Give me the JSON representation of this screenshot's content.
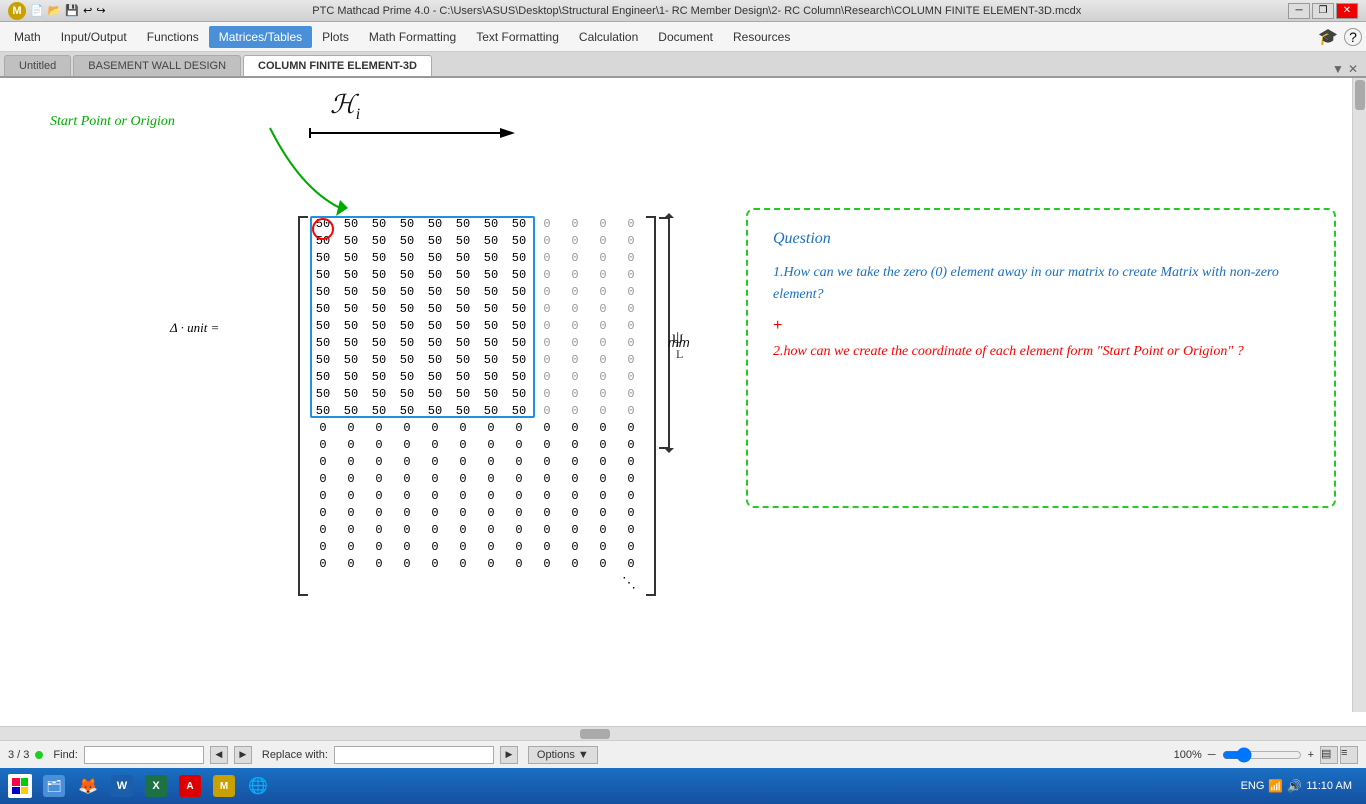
{
  "titlebar": {
    "icon_label": "M",
    "title": "PTC Mathcad Prime 4.0 - C:\\Users\\ASUS\\Desktop\\Structural Engineer\\1- RC Member Design\\2- RC Column\\Research\\COLUMN FINITE ELEMENT-3D.mcdx",
    "minimize": "─",
    "restore": "❐",
    "close": "✕"
  },
  "menubar": {
    "items": [
      "Math",
      "Input/Output",
      "Functions",
      "Matrices/Tables",
      "Plots",
      "Math Formatting",
      "Text Formatting",
      "Calculation",
      "Document",
      "Resources"
    ],
    "active_index": 3
  },
  "tabs": {
    "items": [
      "Untitled",
      "BASEMENT WALL DESIGN",
      "COLUMN FINITE ELEMENT-3D"
    ],
    "active_index": 2,
    "close_symbol": "▼ ✕"
  },
  "annotation": {
    "start_point_label": "Start Point or Origion",
    "matrix_label": "Δ · unit =",
    "mm_label": "mm",
    "question_title": "Question",
    "question_1": "1.How can we take the zero (0) element away in our matrix to create Matrix with non-zero element?",
    "plus_sign": "+",
    "question_2": "2.how can we create the coordinate of each element form \"Start Point or Origion\" ?"
  },
  "matrix": {
    "rows_50": [
      [
        50,
        50,
        50,
        50,
        50,
        50,
        50,
        50,
        0,
        0,
        0,
        0
      ],
      [
        50,
        50,
        50,
        50,
        50,
        50,
        50,
        50,
        0,
        0,
        0,
        0
      ],
      [
        50,
        50,
        50,
        50,
        50,
        50,
        50,
        50,
        0,
        0,
        0,
        0
      ],
      [
        50,
        50,
        50,
        50,
        50,
        50,
        50,
        50,
        0,
        0,
        0,
        0
      ],
      [
        50,
        50,
        50,
        50,
        50,
        50,
        50,
        50,
        0,
        0,
        0,
        0
      ],
      [
        50,
        50,
        50,
        50,
        50,
        50,
        50,
        50,
        0,
        0,
        0,
        0
      ],
      [
        50,
        50,
        50,
        50,
        50,
        50,
        50,
        50,
        0,
        0,
        0,
        0
      ],
      [
        50,
        50,
        50,
        50,
        50,
        50,
        50,
        50,
        0,
        0,
        0,
        0
      ],
      [
        50,
        50,
        50,
        50,
        50,
        50,
        50,
        50,
        0,
        0,
        0,
        0
      ],
      [
        50,
        50,
        50,
        50,
        50,
        50,
        50,
        50,
        0,
        0,
        0,
        0
      ],
      [
        50,
        50,
        50,
        50,
        50,
        50,
        50,
        50,
        0,
        0,
        0,
        0
      ],
      [
        50,
        50,
        50,
        50,
        50,
        50,
        50,
        50,
        0,
        0,
        0,
        0
      ]
    ],
    "rows_0": [
      [
        0,
        0,
        0,
        0,
        0,
        0,
        0,
        0,
        0,
        0,
        0,
        0
      ],
      [
        0,
        0,
        0,
        0,
        0,
        0,
        0,
        0,
        0,
        0,
        0,
        0
      ],
      [
        0,
        0,
        0,
        0,
        0,
        0,
        0,
        0,
        0,
        0,
        0,
        0
      ],
      [
        0,
        0,
        0,
        0,
        0,
        0,
        0,
        0,
        0,
        0,
        0,
        0
      ],
      [
        0,
        0,
        0,
        0,
        0,
        0,
        0,
        0,
        0,
        0,
        0,
        0
      ],
      [
        0,
        0,
        0,
        0,
        0,
        0,
        0,
        0,
        0,
        0,
        0,
        0
      ],
      [
        0,
        0,
        0,
        0,
        0,
        0,
        0,
        0,
        0,
        0,
        0,
        0
      ],
      [
        0,
        0,
        0,
        0,
        0,
        0,
        0,
        0,
        0,
        0,
        0,
        0
      ]
    ]
  },
  "statusbar": {
    "page_info": "3 / 3",
    "find_label": "Find:",
    "find_placeholder": "",
    "replace_label": "Replace with:",
    "replace_placeholder": "",
    "options_label": "Options",
    "zoom_label": "100%"
  },
  "taskbar": {
    "time": "11:10 AM",
    "language": "ENG"
  },
  "colors": {
    "accent_blue": "#1a6fc4",
    "accent_green": "#22cc22",
    "annotation_green": "#00aa00",
    "question_blue": "#1a6fc4",
    "question_red": "#cc0000",
    "matrix_highlight": "#2090e0"
  }
}
